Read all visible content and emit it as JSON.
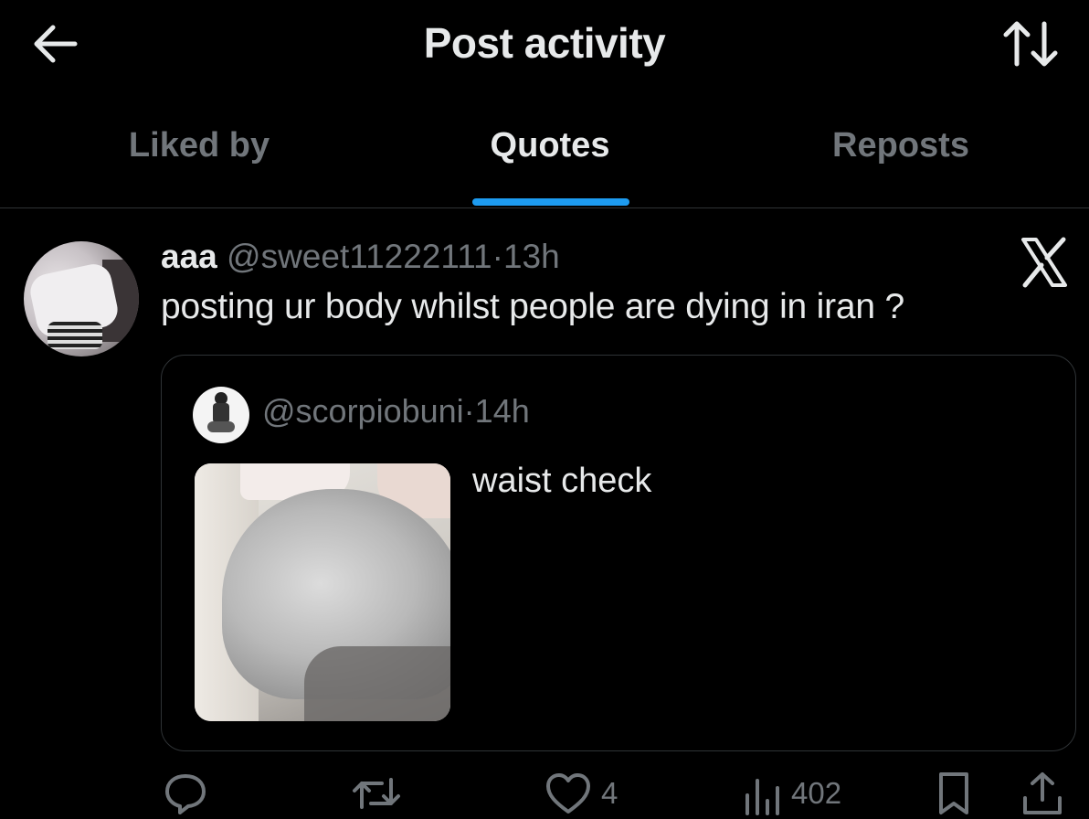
{
  "header": {
    "title": "Post activity",
    "back_icon": "arrow-left-icon",
    "sort_icon": "sort-arrows-icon"
  },
  "tabs": [
    {
      "label": "Liked by",
      "active": false
    },
    {
      "label": "Quotes",
      "active": true
    },
    {
      "label": "Reposts",
      "active": false
    }
  ],
  "post": {
    "display_name": "aaa",
    "handle": "@sweet11222111",
    "separator": "·",
    "time": "13h",
    "text": "posting ur body whilst people are dying in iran ?",
    "source_icon": "x-logo-icon",
    "quoted": {
      "handle": "@scorpiobuni",
      "separator": "·",
      "time": "14h",
      "text": "waist check"
    },
    "actions": {
      "reply_icon": "reply-icon",
      "repost_icon": "repost-icon",
      "like_icon": "heart-icon",
      "like_count": "4",
      "views_icon": "views-icon",
      "views_count": "402",
      "bookmark_icon": "bookmark-icon",
      "share_icon": "share-icon"
    }
  },
  "colors": {
    "background": "#000000",
    "text_primary": "#e7e9ea",
    "text_secondary": "#71767b",
    "accent": "#1d9bf0",
    "divider": "#2f3336"
  }
}
